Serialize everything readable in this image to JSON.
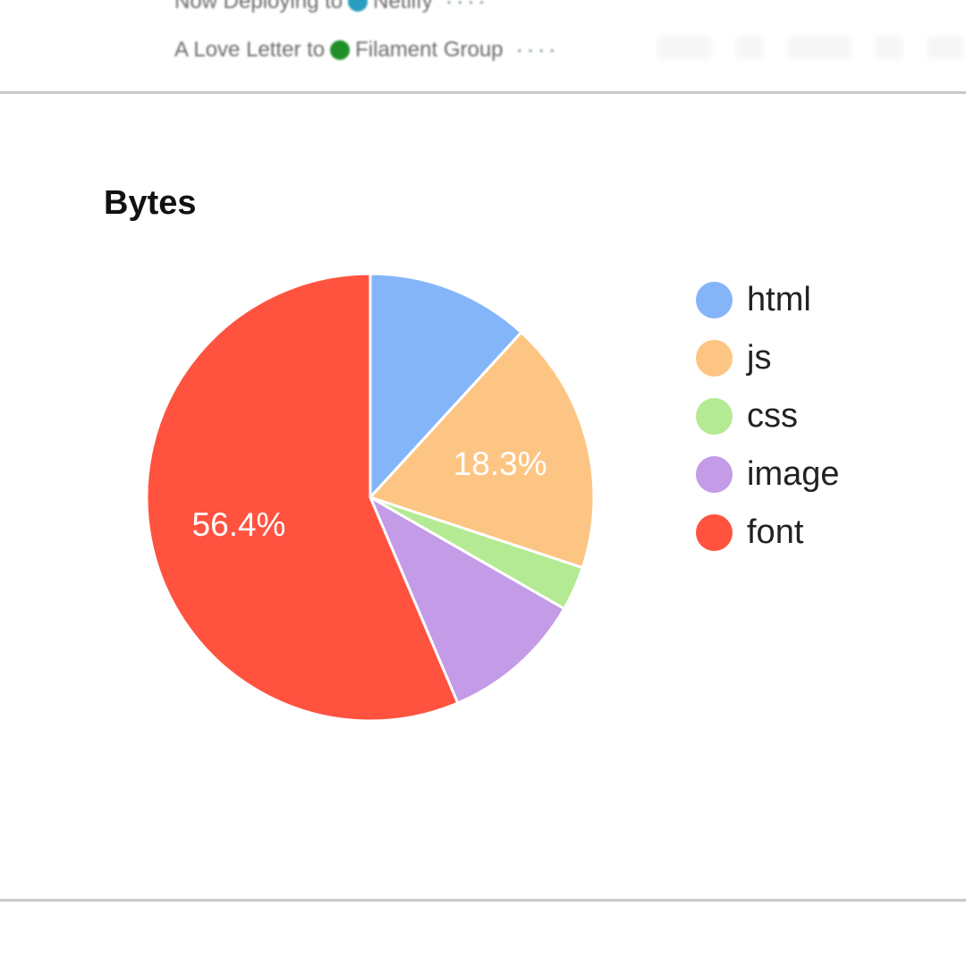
{
  "posts": [
    {
      "prefix": "Now Deploying to",
      "brand": "Netlify",
      "brand_color": "#2a9dc0",
      "meta": "• • • •"
    },
    {
      "prefix": "A Love Letter to",
      "brand": "Filament Group",
      "brand_color": "#1f8f2a",
      "meta": "• • • •"
    }
  ],
  "chart_data": {
    "type": "pie",
    "title": "Bytes",
    "legend_position": "right",
    "slices": [
      {
        "label": "html",
        "value": 11.8,
        "color": "#85b5f9",
        "value_label": ""
      },
      {
        "label": "js",
        "value": 18.3,
        "color": "#fdc583",
        "value_label": "18.3%"
      },
      {
        "label": "css",
        "value": 3.2,
        "color": "#b4ea93",
        "value_label": ""
      },
      {
        "label": "image",
        "value": 10.3,
        "color": "#c49be6",
        "value_label": ""
      },
      {
        "label": "font",
        "value": 56.4,
        "color": "#ff5340",
        "value_label": "56.4%"
      }
    ]
  }
}
